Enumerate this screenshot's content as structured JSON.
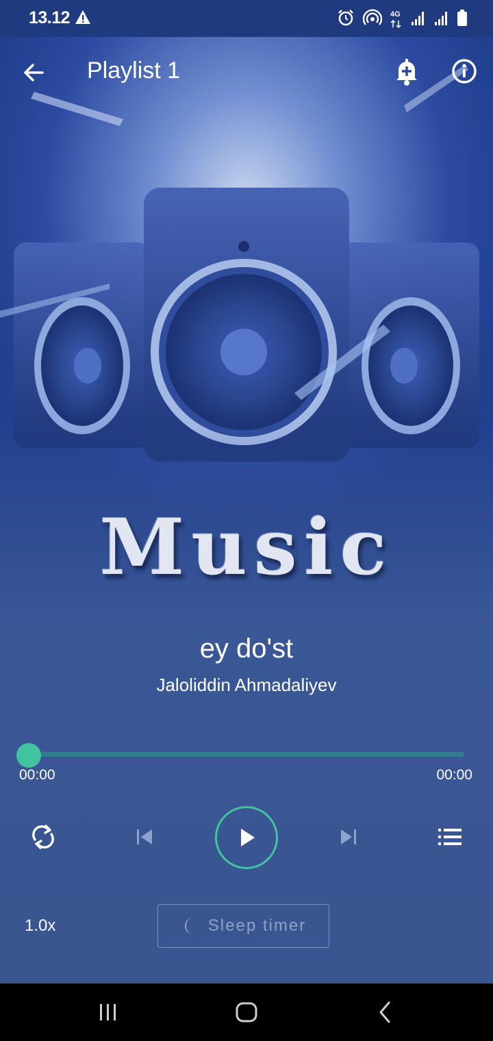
{
  "status_bar": {
    "time": "13.12",
    "icons": [
      "warning-icon",
      "alarm-icon",
      "hotspot-icon",
      "4g-icon",
      "signal-icon",
      "signal-icon",
      "battery-icon"
    ],
    "network_label": "4G"
  },
  "app_bar": {
    "title": "Playlist 1",
    "back_icon": "arrow-back-icon",
    "alarm_icon": "alarm-add-icon",
    "info_icon": "info-icon"
  },
  "artwork": {
    "caption": "Music"
  },
  "track": {
    "title": "ey do'st",
    "artist": "Jaloliddin Ahmadaliyev"
  },
  "progress": {
    "current": "00:00",
    "total": "00:00",
    "fraction": 0.0
  },
  "controls": {
    "repeat_icon": "repeat-icon",
    "prev_icon": "skip-previous-icon",
    "play_icon": "play-icon",
    "next_icon": "skip-next-icon",
    "queue_icon": "queue-list-icon",
    "speed": "1.0x",
    "sleep_timer": "Sleep timer",
    "sleep_icon": "moon-icon"
  },
  "colors": {
    "accent": "#43c4a1",
    "background": "#36538f",
    "status_bar": "#1f3a7f"
  },
  "nav_bar": {
    "icons": [
      "recents-icon",
      "home-icon",
      "back-icon"
    ]
  }
}
